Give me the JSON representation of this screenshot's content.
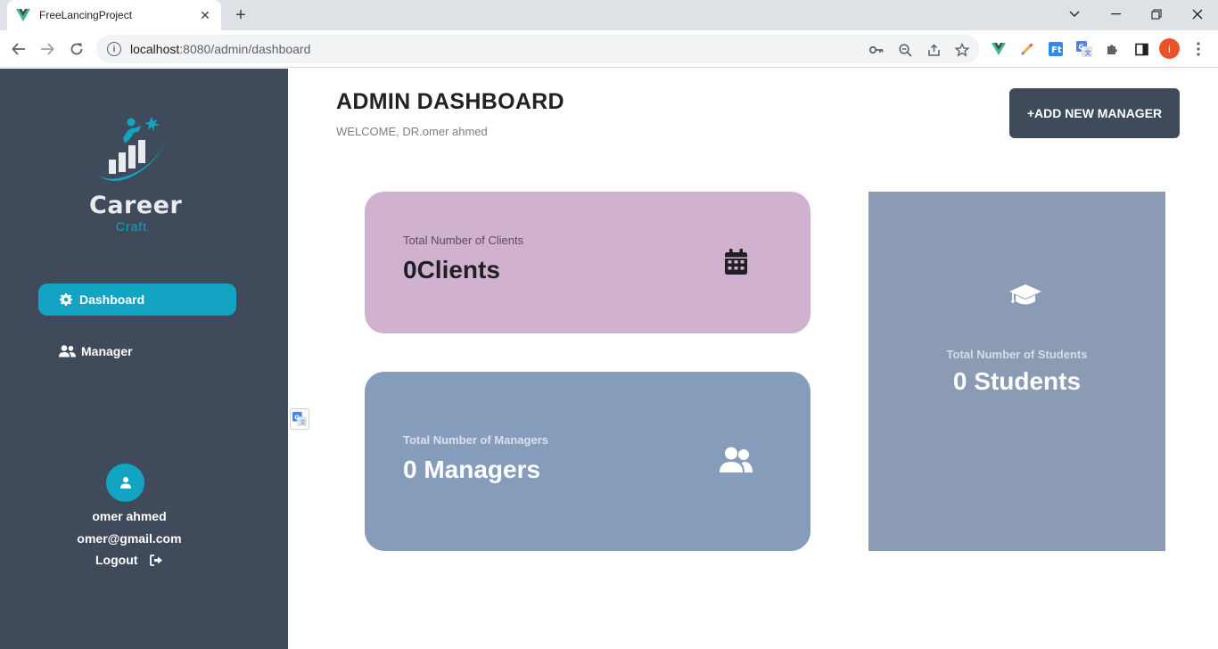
{
  "browser": {
    "tab_title": "FreeLancingProject",
    "url_host": "localhost",
    "url_path": ":8080/admin/dashboard",
    "profile_initial": "i"
  },
  "sidebar": {
    "brand_line1": "Career",
    "brand_line2": "Craft",
    "items": [
      {
        "label": "Dashboard",
        "icon": "gear-icon",
        "active": true
      },
      {
        "label": "Manager",
        "icon": "users-icon",
        "active": false
      }
    ],
    "user": {
      "name": "omer ahmed",
      "email": "omer@gmail.com",
      "logout_label": "Logout"
    }
  },
  "header": {
    "title": "ADMIN DASHBOARD",
    "welcome": "WELCOME, DR.omer ahmed",
    "add_button": "+ADD NEW MANAGER"
  },
  "cards": {
    "clients": {
      "label": "Total Number of Clients",
      "value": "0Clients",
      "icon": "calendar-icon"
    },
    "managers": {
      "label": "Total Number of Managers",
      "value": "0 Managers",
      "icon": "users-icon"
    },
    "students": {
      "label": "Total Number of Students",
      "value": "0 Students",
      "icon": "graduation-cap-icon"
    }
  },
  "colors": {
    "sidebar_bg": "#3f4b5b",
    "accent": "#13a3c3",
    "clients_card": "#d0b1cf",
    "managers_card": "#869cbb",
    "students_card": "#8a9bb3"
  }
}
